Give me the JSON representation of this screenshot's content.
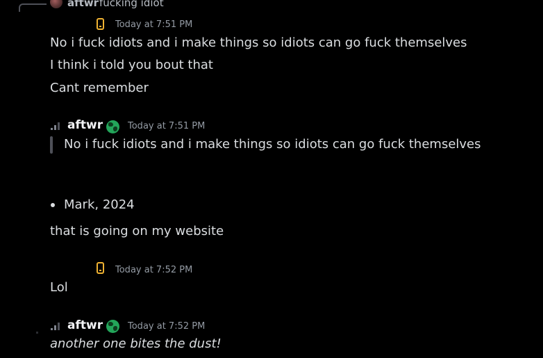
{
  "reply": {
    "author": "aftwr",
    "text": "fucking idiot"
  },
  "group1": {
    "timestamp": "Today at 7:51 PM",
    "messages": [
      "No i fuck idiots and i make things so idiots can go fuck themselves",
      "I think i told you bout that",
      "Cant remember"
    ]
  },
  "group2": {
    "author": "aftwr",
    "timestamp": "Today at 7:51 PM",
    "quote": "No i fuck idiots and i make things so idiots can go fuck themselves",
    "bullet": "Mark, 2024",
    "message": "that is going on my website"
  },
  "group3": {
    "timestamp": "Today at 7:52 PM",
    "message": "Lol"
  },
  "group4": {
    "author": "aftwr",
    "timestamp": "Today at 7:52 PM",
    "message": "another one bites the dust!"
  },
  "colors": {
    "background": "#000000",
    "text": "#dbdee1",
    "timestamp": "#949ba4",
    "mobile_icon": "#f0b232",
    "globe_badge": "#23a55a"
  },
  "icons": [
    "reply-connector",
    "avatar",
    "mobile-phone-icon",
    "signal-icon",
    "globe-icon"
  ]
}
